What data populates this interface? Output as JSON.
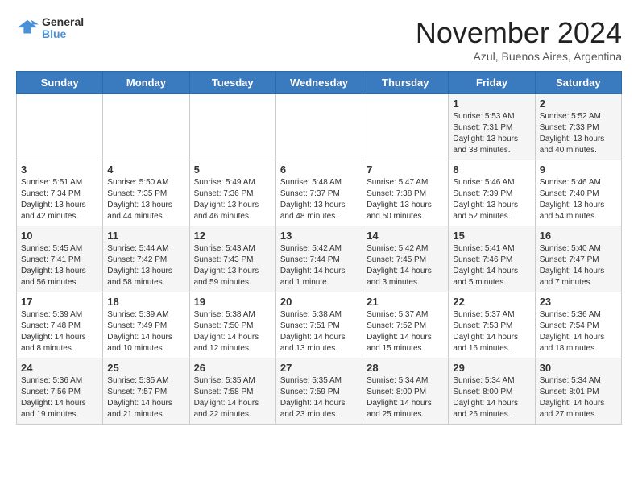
{
  "header": {
    "logo_line1": "General",
    "logo_line2": "Blue",
    "month_title": "November 2024",
    "location": "Azul, Buenos Aires, Argentina"
  },
  "weekdays": [
    "Sunday",
    "Monday",
    "Tuesday",
    "Wednesday",
    "Thursday",
    "Friday",
    "Saturday"
  ],
  "weeks": [
    [
      {
        "day": "",
        "info": ""
      },
      {
        "day": "",
        "info": ""
      },
      {
        "day": "",
        "info": ""
      },
      {
        "day": "",
        "info": ""
      },
      {
        "day": "",
        "info": ""
      },
      {
        "day": "1",
        "info": "Sunrise: 5:53 AM\nSunset: 7:31 PM\nDaylight: 13 hours\nand 38 minutes."
      },
      {
        "day": "2",
        "info": "Sunrise: 5:52 AM\nSunset: 7:33 PM\nDaylight: 13 hours\nand 40 minutes."
      }
    ],
    [
      {
        "day": "3",
        "info": "Sunrise: 5:51 AM\nSunset: 7:34 PM\nDaylight: 13 hours\nand 42 minutes."
      },
      {
        "day": "4",
        "info": "Sunrise: 5:50 AM\nSunset: 7:35 PM\nDaylight: 13 hours\nand 44 minutes."
      },
      {
        "day": "5",
        "info": "Sunrise: 5:49 AM\nSunset: 7:36 PM\nDaylight: 13 hours\nand 46 minutes."
      },
      {
        "day": "6",
        "info": "Sunrise: 5:48 AM\nSunset: 7:37 PM\nDaylight: 13 hours\nand 48 minutes."
      },
      {
        "day": "7",
        "info": "Sunrise: 5:47 AM\nSunset: 7:38 PM\nDaylight: 13 hours\nand 50 minutes."
      },
      {
        "day": "8",
        "info": "Sunrise: 5:46 AM\nSunset: 7:39 PM\nDaylight: 13 hours\nand 52 minutes."
      },
      {
        "day": "9",
        "info": "Sunrise: 5:46 AM\nSunset: 7:40 PM\nDaylight: 13 hours\nand 54 minutes."
      }
    ],
    [
      {
        "day": "10",
        "info": "Sunrise: 5:45 AM\nSunset: 7:41 PM\nDaylight: 13 hours\nand 56 minutes."
      },
      {
        "day": "11",
        "info": "Sunrise: 5:44 AM\nSunset: 7:42 PM\nDaylight: 13 hours\nand 58 minutes."
      },
      {
        "day": "12",
        "info": "Sunrise: 5:43 AM\nSunset: 7:43 PM\nDaylight: 13 hours\nand 59 minutes."
      },
      {
        "day": "13",
        "info": "Sunrise: 5:42 AM\nSunset: 7:44 PM\nDaylight: 14 hours\nand 1 minute."
      },
      {
        "day": "14",
        "info": "Sunrise: 5:42 AM\nSunset: 7:45 PM\nDaylight: 14 hours\nand 3 minutes."
      },
      {
        "day": "15",
        "info": "Sunrise: 5:41 AM\nSunset: 7:46 PM\nDaylight: 14 hours\nand 5 minutes."
      },
      {
        "day": "16",
        "info": "Sunrise: 5:40 AM\nSunset: 7:47 PM\nDaylight: 14 hours\nand 7 minutes."
      }
    ],
    [
      {
        "day": "17",
        "info": "Sunrise: 5:39 AM\nSunset: 7:48 PM\nDaylight: 14 hours\nand 8 minutes."
      },
      {
        "day": "18",
        "info": "Sunrise: 5:39 AM\nSunset: 7:49 PM\nDaylight: 14 hours\nand 10 minutes."
      },
      {
        "day": "19",
        "info": "Sunrise: 5:38 AM\nSunset: 7:50 PM\nDaylight: 14 hours\nand 12 minutes."
      },
      {
        "day": "20",
        "info": "Sunrise: 5:38 AM\nSunset: 7:51 PM\nDaylight: 14 hours\nand 13 minutes."
      },
      {
        "day": "21",
        "info": "Sunrise: 5:37 AM\nSunset: 7:52 PM\nDaylight: 14 hours\nand 15 minutes."
      },
      {
        "day": "22",
        "info": "Sunrise: 5:37 AM\nSunset: 7:53 PM\nDaylight: 14 hours\nand 16 minutes."
      },
      {
        "day": "23",
        "info": "Sunrise: 5:36 AM\nSunset: 7:54 PM\nDaylight: 14 hours\nand 18 minutes."
      }
    ],
    [
      {
        "day": "24",
        "info": "Sunrise: 5:36 AM\nSunset: 7:56 PM\nDaylight: 14 hours\nand 19 minutes."
      },
      {
        "day": "25",
        "info": "Sunrise: 5:35 AM\nSunset: 7:57 PM\nDaylight: 14 hours\nand 21 minutes."
      },
      {
        "day": "26",
        "info": "Sunrise: 5:35 AM\nSunset: 7:58 PM\nDaylight: 14 hours\nand 22 minutes."
      },
      {
        "day": "27",
        "info": "Sunrise: 5:35 AM\nSunset: 7:59 PM\nDaylight: 14 hours\nand 23 minutes."
      },
      {
        "day": "28",
        "info": "Sunrise: 5:34 AM\nSunset: 8:00 PM\nDaylight: 14 hours\nand 25 minutes."
      },
      {
        "day": "29",
        "info": "Sunrise: 5:34 AM\nSunset: 8:00 PM\nDaylight: 14 hours\nand 26 minutes."
      },
      {
        "day": "30",
        "info": "Sunrise: 5:34 AM\nSunset: 8:01 PM\nDaylight: 14 hours\nand 27 minutes."
      }
    ]
  ]
}
